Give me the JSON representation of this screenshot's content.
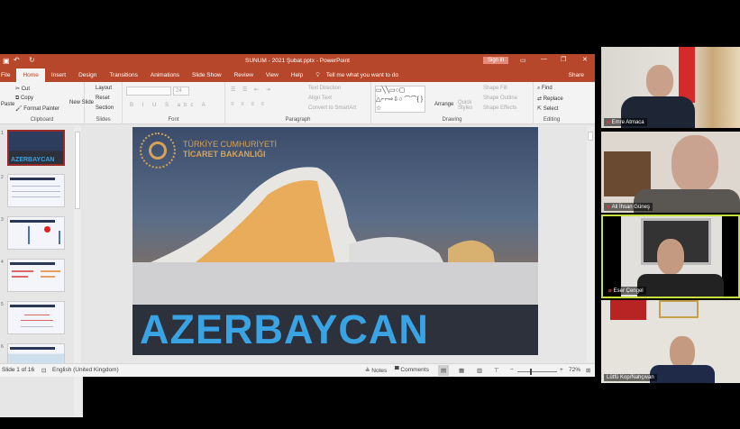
{
  "window": {
    "title": "SUNUM - 2021 Şubat.pptx - PowerPoint",
    "sign_in": "Sign in",
    "share": "Share",
    "tell_me": "Tell me what you want to do"
  },
  "tabs": [
    "File",
    "Home",
    "Insert",
    "Design",
    "Transitions",
    "Animations",
    "Slide Show",
    "Review",
    "View",
    "Help"
  ],
  "active_tab": "Home",
  "ribbon": {
    "clipboard": {
      "label": "Clipboard",
      "paste": "Paste",
      "cut": "Cut",
      "copy": "Copy",
      "format_painter": "Format Painter"
    },
    "slides": {
      "label": "Slides",
      "new_slide": "New Slide",
      "layout": "Layout",
      "reset": "Reset",
      "section": "Section"
    },
    "font": {
      "label": "Font",
      "size": "24"
    },
    "paragraph": {
      "label": "Paragraph",
      "text_direction": "Text Direction",
      "align_text": "Align Text",
      "convert": "Convert to SmartArt"
    },
    "drawing": {
      "label": "Drawing",
      "arrange": "Arrange",
      "quick_styles": "Quick Styles",
      "shape_fill": "Shape Fill",
      "shape_outline": "Shape Outline",
      "shape_effects": "Shape Effects"
    },
    "editing": {
      "label": "Editing",
      "find": "Find",
      "replace": "Replace",
      "select": "Select"
    }
  },
  "slide": {
    "logo_line1": "TÜRKİYE CUMHURİYETİ",
    "logo_line2": "TİCARET BAKANLIĞI",
    "title": "AZERBAYCAN"
  },
  "thumbnails": [
    {
      "n": "1",
      "title": "AZERBAYCAN"
    },
    {
      "n": "2"
    },
    {
      "n": "3"
    },
    {
      "n": "4"
    },
    {
      "n": "5"
    },
    {
      "n": "6"
    }
  ],
  "status": {
    "slide": "Slide 1 of 16",
    "language": "English (United Kingdom)",
    "notes": "Notes",
    "comments": "Comments",
    "zoom": "72%"
  },
  "participants": [
    {
      "name": "Emre Atmaca"
    },
    {
      "name": "Ali İhsan Güneş"
    },
    {
      "name": "Eser Çengel",
      "active": true
    },
    {
      "name": "Lütfü Kop/Nahçıvan"
    }
  ],
  "colors": {
    "accent": "#b7472a",
    "slide_title": "#3aa3e3",
    "active_speaker": "#c8e03c"
  }
}
